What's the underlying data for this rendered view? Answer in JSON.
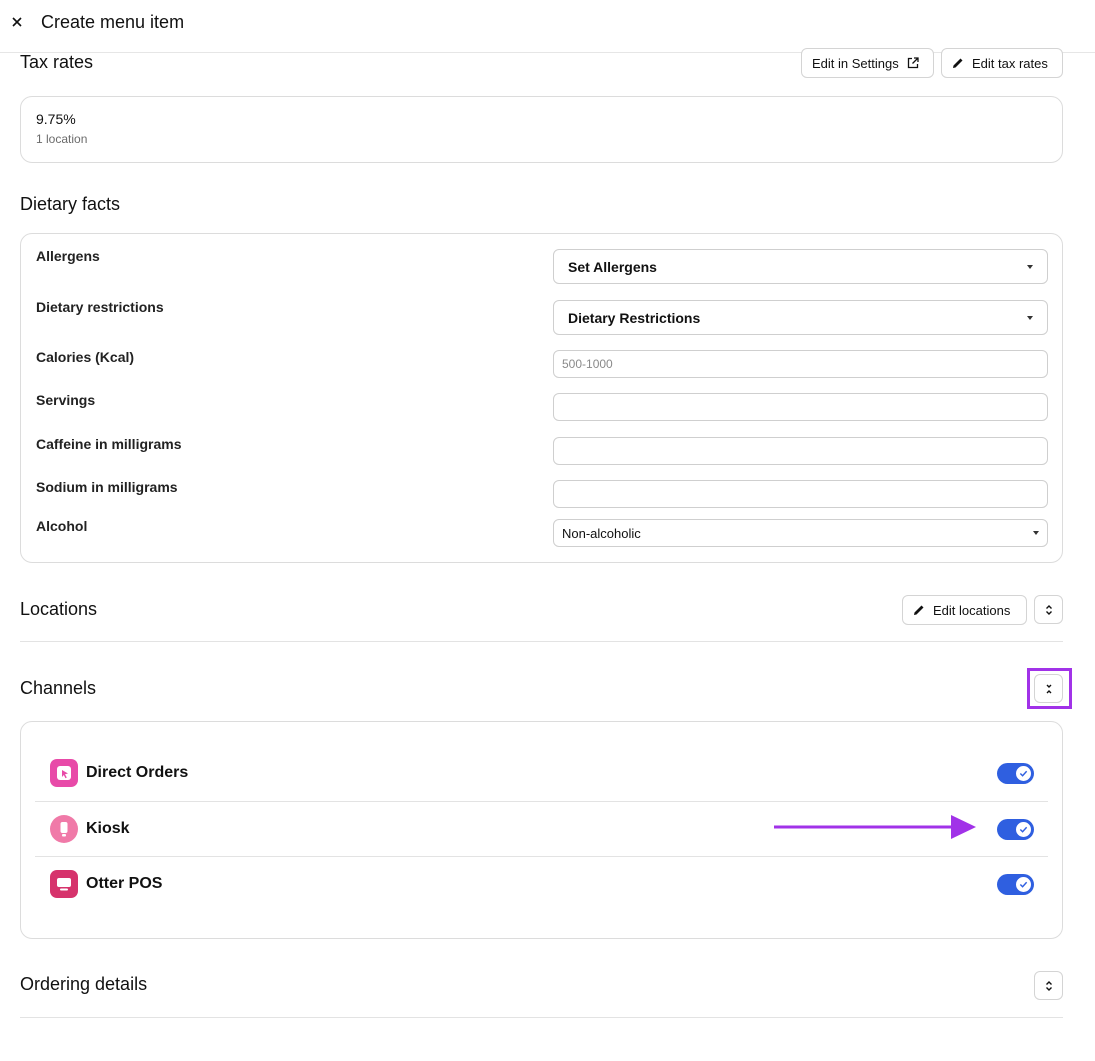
{
  "header": {
    "title": "Create menu item",
    "close_icon": "close-icon"
  },
  "tax_rates": {
    "title": "Tax rates",
    "edit_settings_label": "Edit in Settings",
    "edit_tax_rates_label": "Edit tax rates",
    "rate": "9.75%",
    "locations_count": "1 location"
  },
  "dietary": {
    "title": "Dietary facts",
    "allergens_label": "Allergens",
    "allergens_value": "Set Allergens",
    "restrictions_label": "Dietary restrictions",
    "restrictions_value": "Dietary Restrictions",
    "calories_label": "Calories (Kcal)",
    "calories_placeholder": "500-1000",
    "servings_label": "Servings",
    "caffeine_label": "Caffeine in milligrams",
    "sodium_label": "Sodium in milligrams",
    "alcohol_label": "Alcohol",
    "alcohol_value": "Non-alcoholic"
  },
  "locations": {
    "title": "Locations",
    "edit_label": "Edit locations"
  },
  "channels": {
    "title": "Channels",
    "items": [
      {
        "label": "Direct Orders",
        "enabled": true,
        "icon": "direct-orders-icon",
        "color": "#e84aa8"
      },
      {
        "label": "Kiosk",
        "enabled": true,
        "icon": "kiosk-icon",
        "color": "#f07aa8"
      },
      {
        "label": "Otter POS",
        "enabled": true,
        "icon": "pos-icon",
        "color": "#d6336c"
      }
    ],
    "toggle_color": "#2f5fe0"
  },
  "ordering": {
    "title": "Ordering details"
  },
  "annotation": {
    "highlight_color": "#a132e8"
  }
}
